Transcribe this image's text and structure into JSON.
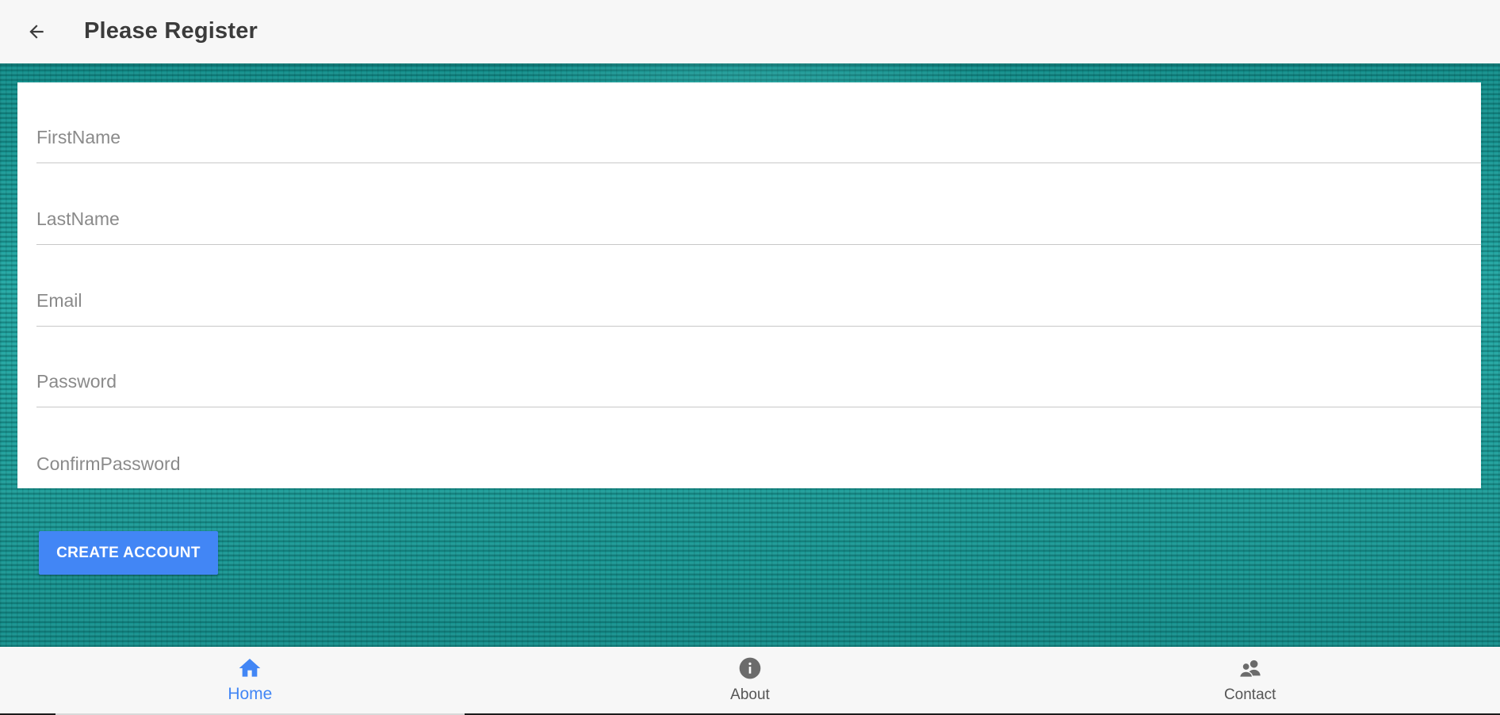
{
  "appbar": {
    "title": "Please Register",
    "back_icon": "arrow-left-icon"
  },
  "form": {
    "fields": [
      {
        "placeholder": "FirstName",
        "value": ""
      },
      {
        "placeholder": "LastName",
        "value": ""
      },
      {
        "placeholder": "Email",
        "value": ""
      },
      {
        "placeholder": "Password",
        "value": ""
      },
      {
        "placeholder": "ConfirmPassword",
        "value": ""
      }
    ],
    "submit_label": "CREATE ACCOUNT"
  },
  "bottom_nav": {
    "items": [
      {
        "label": "Home",
        "icon": "home-icon",
        "active": true
      },
      {
        "label": "About",
        "icon": "info-icon",
        "active": false
      },
      {
        "label": "Contact",
        "icon": "contacts-icon",
        "active": false
      }
    ]
  },
  "colors": {
    "accent": "#4286f5",
    "background": "#1fa3a0",
    "appbar": "#f7f7f7",
    "title_text": "#3b3b3b",
    "inactive_icon": "#6b6b6b"
  }
}
